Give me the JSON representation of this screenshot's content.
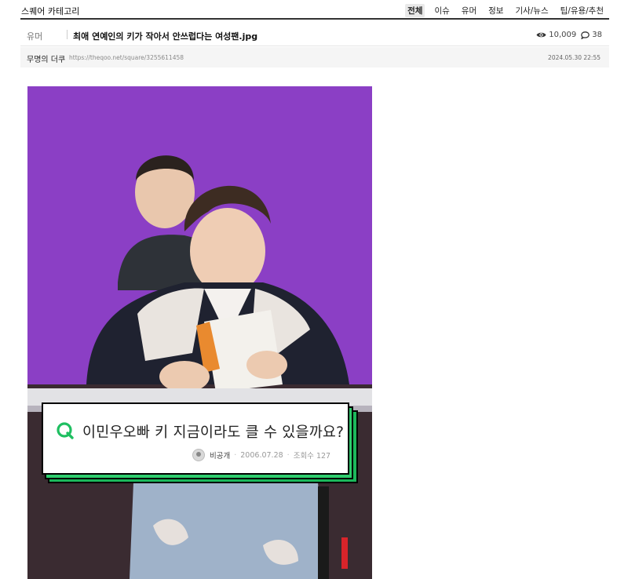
{
  "topbar": {
    "category_prefix": "스퀘어",
    "category_suffix": "카테고리",
    "tabs": [
      {
        "label": "전체",
        "active": true
      },
      {
        "label": "이슈",
        "active": false
      },
      {
        "label": "유머",
        "active": false
      },
      {
        "label": "정보",
        "active": false
      },
      {
        "label": "기사/뉴스",
        "active": false
      },
      {
        "label": "팁/유용/추천",
        "active": false
      }
    ]
  },
  "post": {
    "category": "유머",
    "title": "최애 연예인의 키가 작아서 안쓰럽다는 여성팬.jpg",
    "views": "10,009",
    "comments": "38",
    "author": "무명의 더쿠",
    "url": "https://theqoo.net/square/3255611458",
    "date": "2024.05.30 22:55"
  },
  "image": {
    "question": "이민우오빠 키 지금이라도 클 수 있을까요?",
    "asker": "비공개",
    "asked_date": "2006.07.28",
    "view_label": "조회수 127"
  },
  "colors": {
    "accent_green": "#2fcd6e",
    "backdrop_purple": "#8b3fc5"
  },
  "icons": [
    "eye-icon",
    "comment-icon",
    "q-logo-icon",
    "avatar-icon"
  ]
}
